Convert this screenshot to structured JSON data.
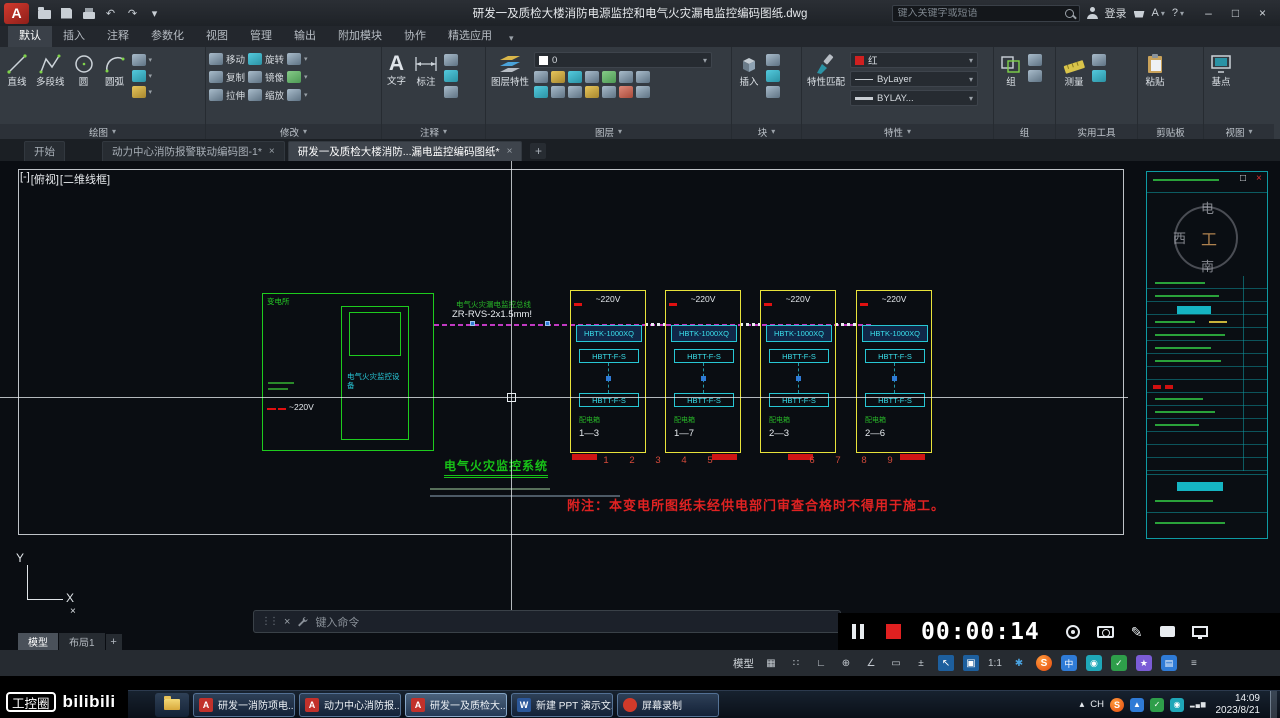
{
  "icons": {
    "caret": "▾",
    "close": "×",
    "minimize": "–",
    "maximize": "□",
    "undo": "↶",
    "redo": "↷",
    "add": "+",
    "grid": "▦",
    "snap": "∷",
    "ortho": "∟",
    "polar": "⊕",
    "osnap": "∠",
    "lwt": "▭",
    "dyn": "±",
    "cursor": "↖",
    "selcycle": "▣",
    "gear": "✱",
    "menu": "≡",
    "grip": "⋮⋮",
    "pencil": "✎",
    "hidden": "▴"
  },
  "titlebar": {
    "title": "研发一及质检大楼消防电源监控和电气火灾漏电监控编码图纸.dwg",
    "search_placeholder": "键入关键字或短语",
    "login": "登录",
    "a_menu": "A",
    "help": "?"
  },
  "ribbon": {
    "tabs": [
      "默认",
      "插入",
      "注释",
      "参数化",
      "视图",
      "管理",
      "输出",
      "附加模块",
      "协作",
      "精选应用"
    ],
    "panels": {
      "draw": {
        "label": "绘图",
        "line": "直线",
        "polyline": "多段线",
        "circle": "圆",
        "arc": "圆弧"
      },
      "modify": {
        "label": "修改",
        "move": "移动",
        "rotate": "旋转",
        "copy": "复制",
        "mirror": "镜像",
        "stretch": "拉伸",
        "scale": "缩放"
      },
      "annotate": {
        "label": "注释",
        "text": "文字",
        "dimension": "标注"
      },
      "layers": {
        "label": "图层",
        "manager": "图层特性",
        "current": "0"
      },
      "block": {
        "label": "块",
        "insert": "插入"
      },
      "properties": {
        "label": "特性",
        "match": "特性匹配",
        "color": "红",
        "linetype": "ByLayer",
        "lineweight": "BYLAY..."
      },
      "groups": {
        "label": "组",
        "group": "组"
      },
      "utilities": {
        "label": "实用工具",
        "measure": "测量"
      },
      "clipboard": {
        "label": "剪贴板",
        "paste": "粘贴"
      },
      "view": {
        "label": "视图",
        "basepoint": "基点"
      }
    }
  },
  "filetabs": {
    "start": "开始",
    "tab1": "动力中心消防报警联动编码图-1*",
    "tab2": "研发一及质检大楼消防...漏电监控编码图纸*"
  },
  "canvas": {
    "viewport_controls": {
      "pan": "[-]",
      "view": "[俯视]",
      "style": "[二维线框]"
    },
    "supply": {
      "name": "变电所",
      "device": "电气火灾监控设备",
      "voltage": "~220V"
    },
    "bus": {
      "label": "电气火灾漏电监控总线",
      "spec": "ZR-RVS-2x1.5mm!"
    },
    "detectors": {
      "voltage": "~220V",
      "controller": "HBTK-1000XQ",
      "sensor": "HBTT-F-S",
      "dest": "配电箱",
      "units": [
        {
          "circuit": "1—3"
        },
        {
          "circuit": "1—7"
        },
        {
          "circuit": "2—3"
        },
        {
          "circuit": "2—6"
        }
      ]
    },
    "numbers": [
      "1",
      "2",
      "3",
      "4",
      "5",
      "6",
      "7",
      "8",
      "9"
    ],
    "system_title": "电气火灾监控系统",
    "note": "附注：本变电所图纸未经供电部门审查合格时不得用于施工。",
    "ucs": {
      "x_label": "X",
      "y_label": "Y"
    },
    "watermark_chars": [
      "电",
      "西",
      "工",
      "南"
    ]
  },
  "commandline": {
    "placeholder": "键入命令"
  },
  "modeltabs": {
    "model": "模型",
    "layout1": "布局1"
  },
  "recorder": {
    "time": "00:00:14"
  },
  "statusbar": {
    "model": "模型",
    "scale": "1:1"
  },
  "ime": {
    "sogou": "S",
    "lang_square": "中"
  },
  "watermark": {
    "badge": "工控圈",
    "brand": "bilibili"
  },
  "taskbar": {
    "acad_letter": "A",
    "word_letter": "W",
    "buttons": [
      "研发一消防项电...",
      "动力中心消防报...",
      "研发一及质检大...",
      "新建 PPT 演示文...",
      "屏幕录制"
    ],
    "tray": {
      "ime": "CH",
      "time": "14:09",
      "date": "2023/8/21"
    }
  }
}
